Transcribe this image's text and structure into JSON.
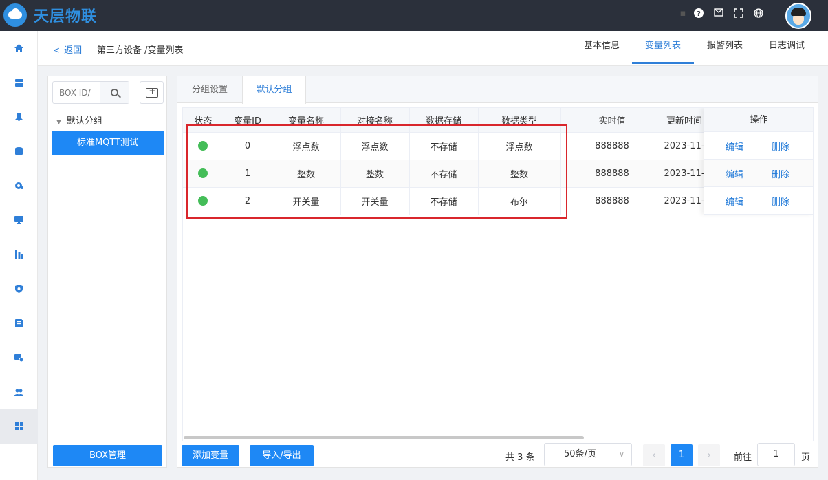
{
  "app": {
    "logo_text": "天层物联"
  },
  "header": {
    "back_label": "返回",
    "breadcrumb": "第三方设备 /变量列表",
    "tabs": [
      {
        "label": "基本信息",
        "active": false
      },
      {
        "label": "变量列表",
        "active": true
      },
      {
        "label": "报警列表",
        "active": false
      },
      {
        "label": "日志调试",
        "active": false
      }
    ]
  },
  "nav": {
    "icons": [
      "home-icon",
      "dashboard-icon",
      "bell-icon",
      "database-icon",
      "settings-icon",
      "monitor-icon",
      "chart-icon",
      "shield-icon",
      "document-icon",
      "device-icon",
      "users-icon",
      "grid-icon"
    ],
    "active_index": 11
  },
  "tree": {
    "search_placeholder": "BOX ID/",
    "group_label": "默认分组",
    "selected_node": "标准MQTT测试",
    "box_button": "BOX管理"
  },
  "group_tabs": [
    {
      "label": "分组设置",
      "active": false
    },
    {
      "label": "默认分组",
      "active": true
    }
  ],
  "table": {
    "columns": [
      "状态",
      "变量ID",
      "变量名称",
      "对接名称",
      "数据存储",
      "数据类型",
      "实时值",
      "更新时间",
      "操作"
    ],
    "rows": [
      {
        "status": "online",
        "id": "0",
        "name": "浮点数",
        "dock_name": "浮点数",
        "storage": "不存储",
        "type": "浮点数",
        "value": "888888",
        "updated": "2023-11-"
      },
      {
        "status": "online",
        "id": "1",
        "name": "整数",
        "dock_name": "整数",
        "storage": "不存储",
        "type": "整数",
        "value": "888888",
        "updated": "2023-11-"
      },
      {
        "status": "online",
        "id": "2",
        "name": "开关量",
        "dock_name": "开关量",
        "storage": "不存储",
        "type": "布尔",
        "value": "888888",
        "updated": "2023-11-"
      }
    ],
    "edit_label": "编辑",
    "delete_label": "删除"
  },
  "footer": {
    "add_button": "添加变量",
    "import_export_button": "导入/导出",
    "total_text": "共 3 条",
    "page_size": "50条/页",
    "current_page": "1",
    "goto_label": "前往",
    "goto_value": "1",
    "goto_unit": "页"
  },
  "colors": {
    "primary": "#1e88f5",
    "topbar": "#2b303b",
    "status_online": "#44bd58",
    "highlight": "#d9262c"
  }
}
